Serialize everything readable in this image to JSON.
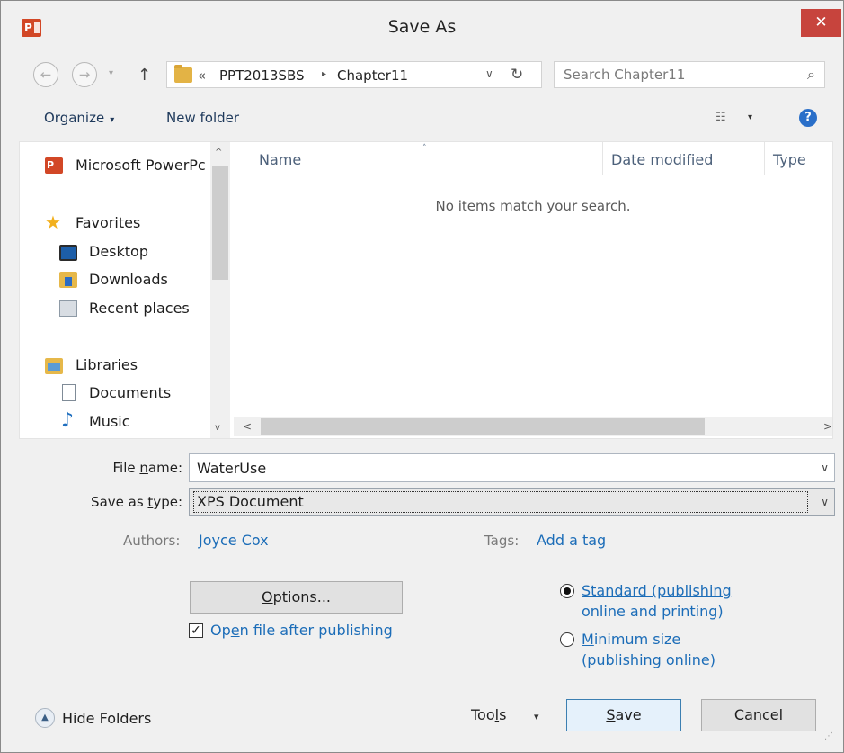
{
  "window": {
    "title": "Save As",
    "app_icon_text": "P",
    "close_glyph": "✕"
  },
  "addressbar": {
    "back_glyph": "←",
    "forward_glyph": "→",
    "recent_glyph": "▾",
    "up_glyph": "↑",
    "overflow": "«",
    "crumbs": [
      "PPT2013SBS",
      "Chapter11"
    ],
    "crumb_sep": "▸",
    "dropdown_glyph": "∨",
    "refresh_glyph": "↻"
  },
  "search": {
    "placeholder": "Search Chapter11",
    "icon": "⌕"
  },
  "toolbar": {
    "organize": "Organize",
    "caret": "▾",
    "new_folder": "New folder",
    "views_glyph": "☷",
    "views_caret": "▾",
    "help_glyph": "?"
  },
  "nav": {
    "items": [
      {
        "label": "Microsoft PowerPc",
        "icon": "powerpoint-icon"
      },
      {
        "label": "Favorites",
        "icon": "star-icon"
      },
      {
        "label": "Desktop",
        "icon": "desktop-icon"
      },
      {
        "label": "Downloads",
        "icon": "downloads-icon"
      },
      {
        "label": "Recent places",
        "icon": "recent-places-icon"
      },
      {
        "label": "Libraries",
        "icon": "libraries-icon"
      },
      {
        "label": "Documents",
        "icon": "documents-icon"
      },
      {
        "label": "Music",
        "icon": "music-icon"
      }
    ],
    "star_glyph": "★",
    "music_glyph": "♪",
    "scroll_up": "^",
    "scroll_down": "v"
  },
  "files": {
    "columns": [
      "Name",
      "Date modified",
      "Type"
    ],
    "sort_glyph": "˄",
    "empty_message": "No items match your search.",
    "hscroll_left": "<",
    "hscroll_right": ">"
  },
  "form": {
    "file_name_label_pre": "File ",
    "file_name_label_u": "n",
    "file_name_label_post": "ame:",
    "file_name_value": "WaterUse",
    "type_label_pre": "Save as ",
    "type_label_u": "t",
    "type_label_post": "ype:",
    "type_value": "XPS Document",
    "dd_glyph": "∨",
    "authors_label": "Authors:",
    "authors_value": "Joyce Cox",
    "tags_label": "Tags:",
    "tags_value": "Add a tag"
  },
  "options": {
    "options_button_u": "O",
    "options_button_rest": "ptions...",
    "open_after_pre": "Op",
    "open_after_u": "e",
    "open_after_post": "n file after publishing",
    "open_after_checked": true,
    "check_glyph": "✓",
    "radio_standard_u": "S",
    "radio_standard_line1": "tandard (publishing",
    "radio_standard_line2": "online and printing)",
    "radio_minimum_u": "M",
    "radio_minimum_line1": "inimum size",
    "radio_minimum_line2": "(publishing online)",
    "selected_radio": "standard"
  },
  "footer": {
    "hide_folders": "Hide Folders",
    "hide_glyph": "▲",
    "tools_pre": "Too",
    "tools_u": "l",
    "tools_post": "s",
    "tools_caret": "▾",
    "save_u": "S",
    "save_rest": "ave",
    "cancel": "Cancel",
    "grip": "⋰"
  }
}
